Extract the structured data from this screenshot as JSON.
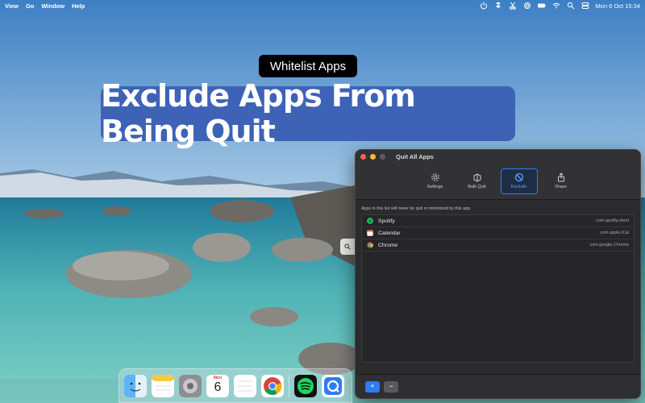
{
  "menubar": {
    "items": [
      "View",
      "Go",
      "Window",
      "Help"
    ],
    "clock": "Mon 6 Oct  15:34"
  },
  "overlay": {
    "badge": "Whitelist Apps",
    "headline": "Exclude Apps From Being Quit"
  },
  "window": {
    "title": "Quit All Apps",
    "tabs": [
      {
        "label": "Settings",
        "icon": "gear-icon"
      },
      {
        "label": "Bulk Quit",
        "icon": "stack-icon"
      },
      {
        "label": "Exclude",
        "icon": "prohibited-icon"
      },
      {
        "label": "Share",
        "icon": "share-icon"
      }
    ],
    "active_tab": "Exclude",
    "note": "Apps in this list will never be quit or minimized by this app.",
    "apps": [
      {
        "name": "Spotify",
        "bundle": "com.spotify.client"
      },
      {
        "name": "Calendar",
        "bundle": "com.apple.iCal"
      },
      {
        "name": "Chrome",
        "bundle": "com.google.Chrome"
      }
    ],
    "footer": {
      "add_label": "+",
      "remove_label": "−"
    }
  },
  "dock": {
    "calendar_month": "Mon",
    "calendar_day": "6",
    "apps": [
      "finder",
      "notes",
      "system-settings",
      "calendar",
      "reminders",
      "chrome",
      "spotify",
      "quit-all-apps"
    ]
  },
  "colors": {
    "accent": "#2f7bf5",
    "banner": "#3e63b6",
    "window_bg": "#2b2b2d"
  }
}
